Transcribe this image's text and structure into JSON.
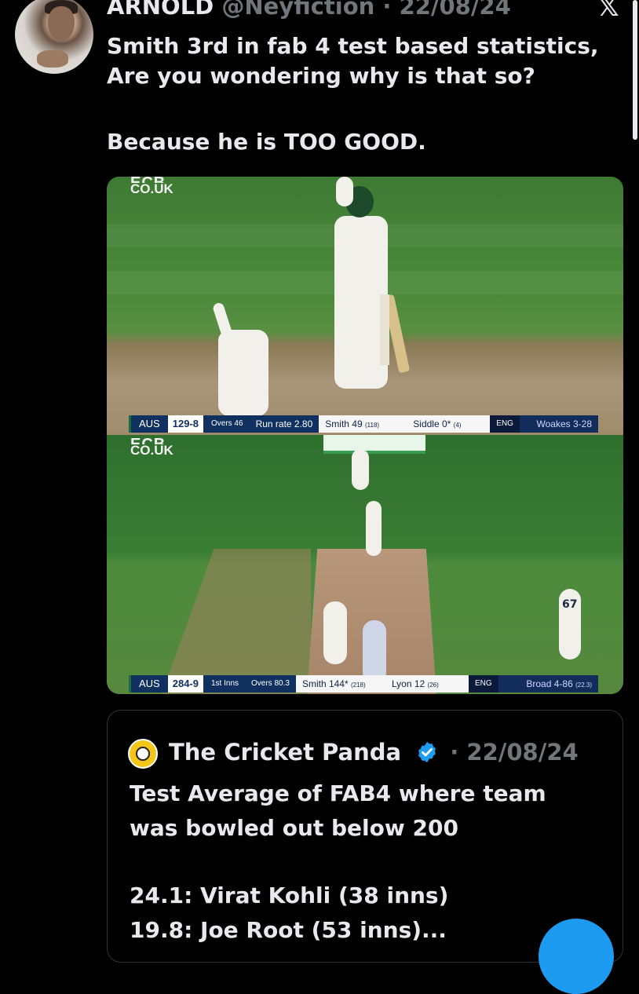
{
  "tweet": {
    "author_name": "ARNOLD",
    "author_handle": "@Neyfiction",
    "separator": "·",
    "date": "22/08/24",
    "text_lines": [
      "Smith 3rd in fab 4 test based statistics,",
      "Are you wondering why is that so?",
      "Because he is TOO GOOD."
    ]
  },
  "icons": {
    "platform_logo": "x-logo-icon",
    "verified": "verified-badge-icon",
    "quote_avatar": "cricket-panda-logo-icon"
  },
  "media": {
    "panel1": {
      "broadcaster_top": "ECB",
      "broadcaster_bottom": "CO.UK",
      "scoreboard": {
        "team": "AUS",
        "score": "129-8",
        "overs": "Overs 46",
        "run_rate": "Run rate 2.80",
        "batter1": "Smith 49",
        "batter1_balls": "(118)",
        "batter2": "Siddle 0*",
        "batter2_balls": "(4)",
        "bowling_team": "ENG",
        "bowler": "Woakes 3-28"
      }
    },
    "panel2": {
      "broadcaster_top": "ECB",
      "broadcaster_bottom": "CO.UK",
      "player_number": "67",
      "scoreboard": {
        "team": "AUS",
        "score": "284-9",
        "innings": "1st Inns",
        "overs": "Overs 80.3",
        "batter1": "Smith 144*",
        "batter1_balls": "(218)",
        "batter2": "Lyon 12",
        "batter2_balls": "(26)",
        "bowling_team": "ENG",
        "bowler": "Broad 4-86",
        "bowler_overs": "(22.3)"
      }
    }
  },
  "quoted_tweet": {
    "author_name": "The Cricket Panda",
    "separator": "·",
    "date": "22/08/24",
    "text_lines": [
      "Test Average of FAB4 where team",
      "was bowled out below 200",
      "24.1: Virat Kohli (38 inns)",
      "19.8: Joe Root (53 inns)..."
    ]
  },
  "colors": {
    "background": "#000000",
    "text": "#e7e9ea",
    "muted": "#71767b",
    "accent": "#1d9bf0",
    "border": "#2f3336"
  }
}
